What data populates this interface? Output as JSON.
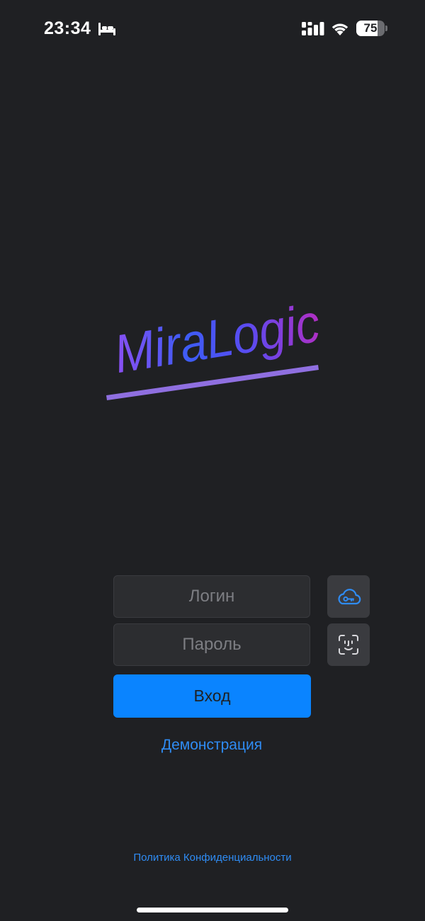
{
  "status_bar": {
    "time": "23:34",
    "battery_level": "75",
    "battery_fraction": 0.75
  },
  "logo": {
    "text": "MiraLogic"
  },
  "form": {
    "login_placeholder": "Логин",
    "password_placeholder": "Пароль",
    "login_button_label": "Вход",
    "cloud_key_icon": "cloud-key-icon",
    "face_id_icon": "face-id-icon"
  },
  "demo_link": "Демонстрация",
  "privacy_link": "Политика Конфиденциальности",
  "colors": {
    "background": "#1f2023",
    "accent": "#0a84ff",
    "logo_gradient_start": "#8a4ff2",
    "logo_gradient_mid": "#3d5cf5",
    "logo_gradient_end": "#b12fc4",
    "underline": "#8f6fe0"
  }
}
